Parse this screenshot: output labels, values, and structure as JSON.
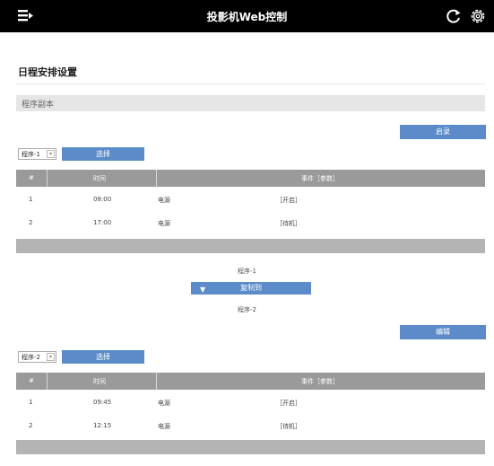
{
  "header": {
    "title": "投影机Web控制",
    "menu_icon": "menu-icon",
    "refresh_icon": "refresh-icon",
    "settings_icon": "gear-icon"
  },
  "page_title": "日程安排设置",
  "section": {
    "label": "程序副本"
  },
  "buttons": {
    "record": "启录",
    "edit": "编辑",
    "select": "选择",
    "copy": "复制到"
  },
  "program_labels": {
    "from": "程序-1",
    "to": "程序-2"
  },
  "tables": [
    {
      "dropdown_value": "程序-1",
      "headers": [
        "#",
        "时间",
        "事件［参数］"
      ],
      "rows": [
        {
          "num": "1",
          "time": "08:00",
          "source": "电源",
          "event": "［开启］"
        },
        {
          "num": "2",
          "time": "17:00",
          "source": "电源",
          "event": "［待机］"
        }
      ]
    },
    {
      "dropdown_value": "程序-2",
      "headers": [
        "#",
        "时间",
        "事件［参数］"
      ],
      "rows": [
        {
          "num": "1",
          "time": "09:45",
          "source": "电源",
          "event": "［开启］"
        },
        {
          "num": "2",
          "time": "12:15",
          "source": "电源",
          "event": "［待机］"
        }
      ]
    }
  ],
  "colors": {
    "topbar": "#000000",
    "accent_button": "#5b8cc9",
    "table_header": "#9a9a9a",
    "band": "#b4b4b4",
    "section_bar": "#e6e6e6"
  }
}
